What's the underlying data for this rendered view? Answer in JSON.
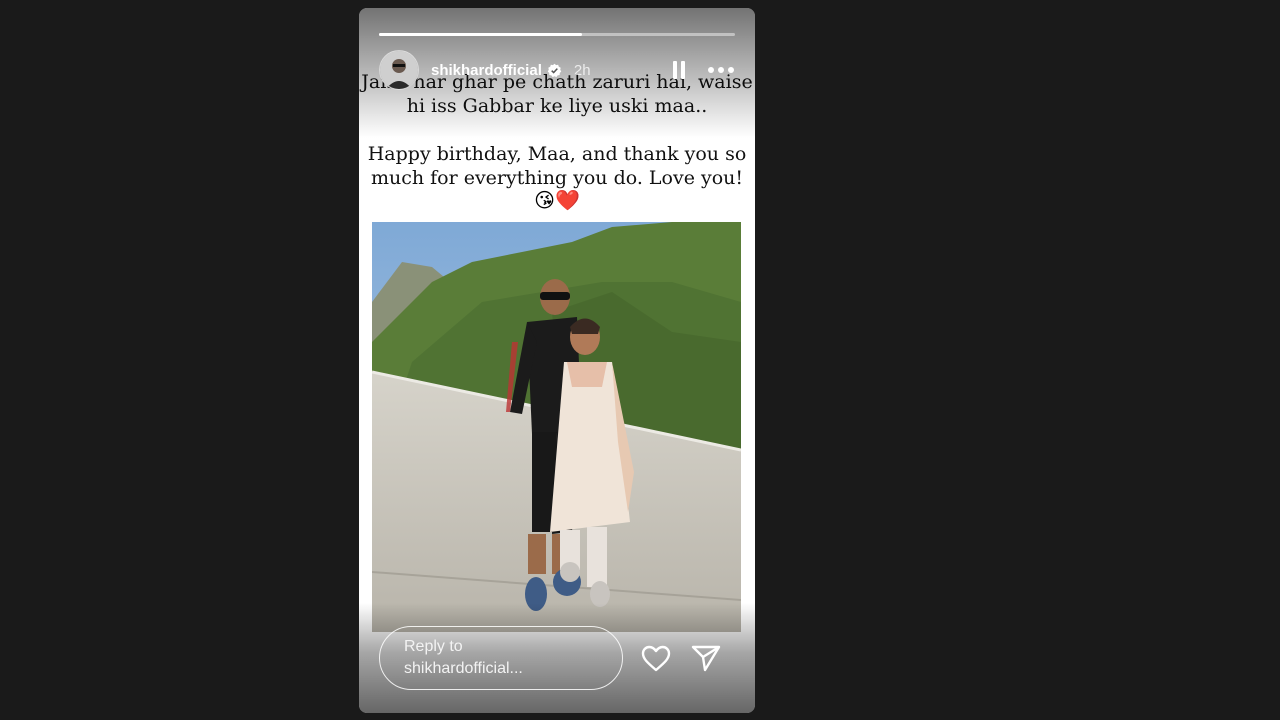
{
  "story": {
    "username": "shikhardofficial",
    "time_ago": "2h",
    "progress": 0.57,
    "caption_line1a": "Jaise har ghar pe chath zaruri hai, waise",
    "caption_line1b": "hi iss Gabbar ke liye uski maa..",
    "caption_line2a": "Happy birthday, Maa, and thank you so",
    "caption_line2b": "much for everything you do. Love you!",
    "emojis": "😘❤️"
  },
  "footer": {
    "reply_line1": "Reply to",
    "reply_line2": "shikhardofficial..."
  },
  "icons": {
    "verified": "verified-badge-icon",
    "pause": "pause-icon",
    "more": "more-icon",
    "like": "heart-icon",
    "share": "send-icon"
  },
  "colors": {
    "background": "#1a1a1a",
    "sky": "#8fb6dc",
    "hills": "#5b7f3a",
    "ground": "#c9c6bd"
  }
}
